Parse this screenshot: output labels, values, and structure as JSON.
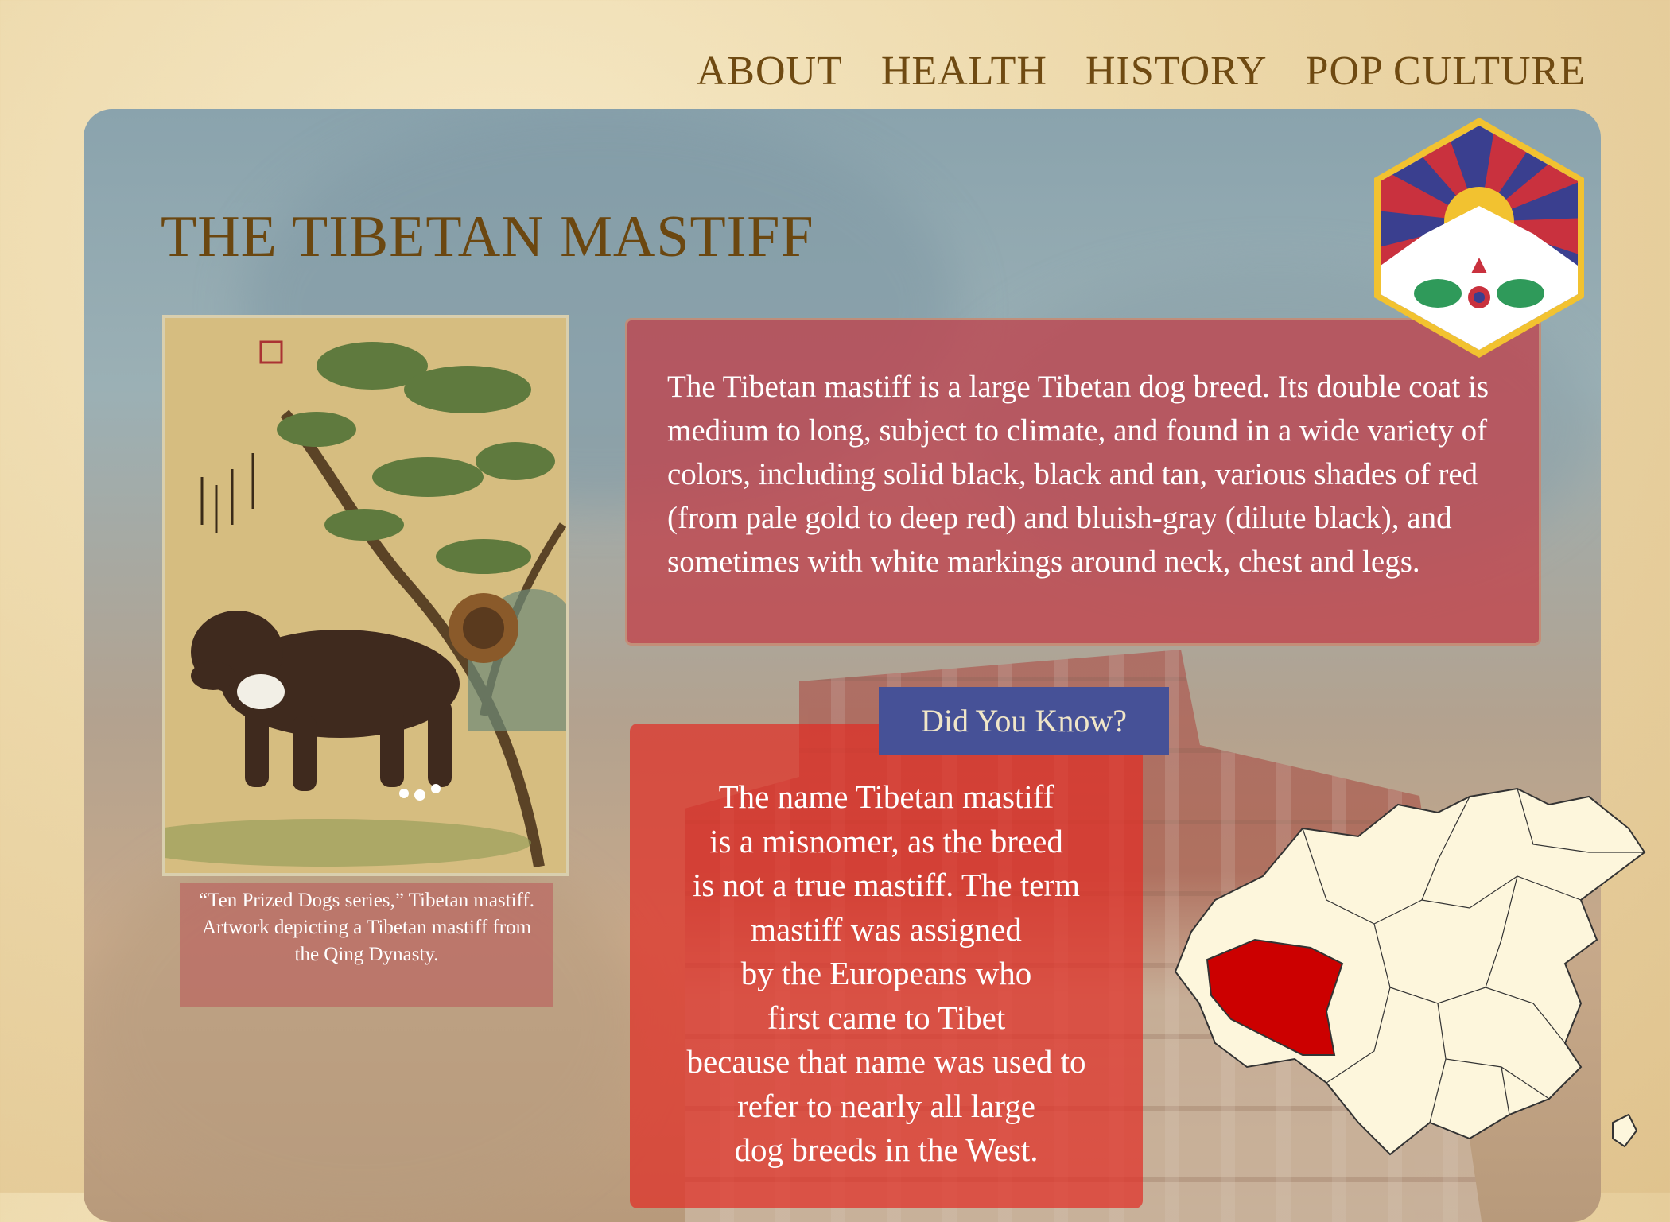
{
  "nav": {
    "items": [
      {
        "label": "ABOUT"
      },
      {
        "label": "HEALTH"
      },
      {
        "label": "HISTORY"
      },
      {
        "label": "POP CULTURE"
      }
    ]
  },
  "page_title": "THE TIBETAN MASTIFF",
  "painting": {
    "caption": "“Ten Prized Dogs series,” Tibetan mastiff. Artwork depicting a Tibetan mastiff  from the Qing Dynasty."
  },
  "description": "The Tibetan mastiff  is a large Tibetan dog breed. Its double coat is medium to long, subject to climate, and found in a wide variety of  colors, including solid black, black and tan, various shades of  red (from pale gold to deep red) and bluish-gray (dilute black), and sometimes with white markings around neck, chest and legs.",
  "did_you_know": {
    "title": "Did You Know?",
    "text": "The name Tibetan mastiff\nis a misnomer, as the breed\nis not a true mastiff. The term\nmastiff  was assigned\nby the Europeans who\nfirst came to Tibet\nbecause that name was used to\nrefer to nearly all large\ndog breeds in the West."
  },
  "colors": {
    "title_brown": "#6b4710",
    "flag_blue": "#3a3f8f",
    "flag_red": "#c9313e",
    "flag_yellow": "#f2c230",
    "map_highlight": "#cc0000",
    "map_fill": "#fdf6dc"
  },
  "icons": {
    "emblem": "snow-lion-flag-icon",
    "map": "china-map-tibet-highlight"
  }
}
